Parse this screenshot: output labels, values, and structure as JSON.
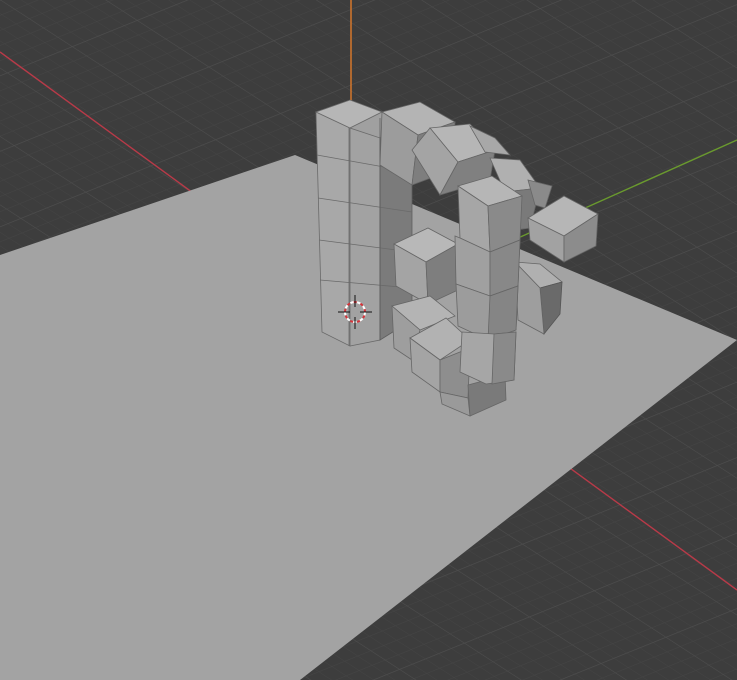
{
  "viewport": {
    "background_color": "#3d3d3d",
    "grid_minor_color": "#454545",
    "grid_major_color": "#4c4c4c",
    "axis_x_color": "#b83a48",
    "axis_y_color": "#6a9a2e",
    "axis_z_color": "#e07b2a"
  },
  "scene": {
    "plane_color": "#a3a3a3",
    "cube_top_color": "#b2b2b2",
    "cube_left_color": "#9c9c9c",
    "cube_right_color": "#7a7a7a",
    "edge_color": "#5a5a5a",
    "cursor_icon": "3d-cursor-icon"
  }
}
